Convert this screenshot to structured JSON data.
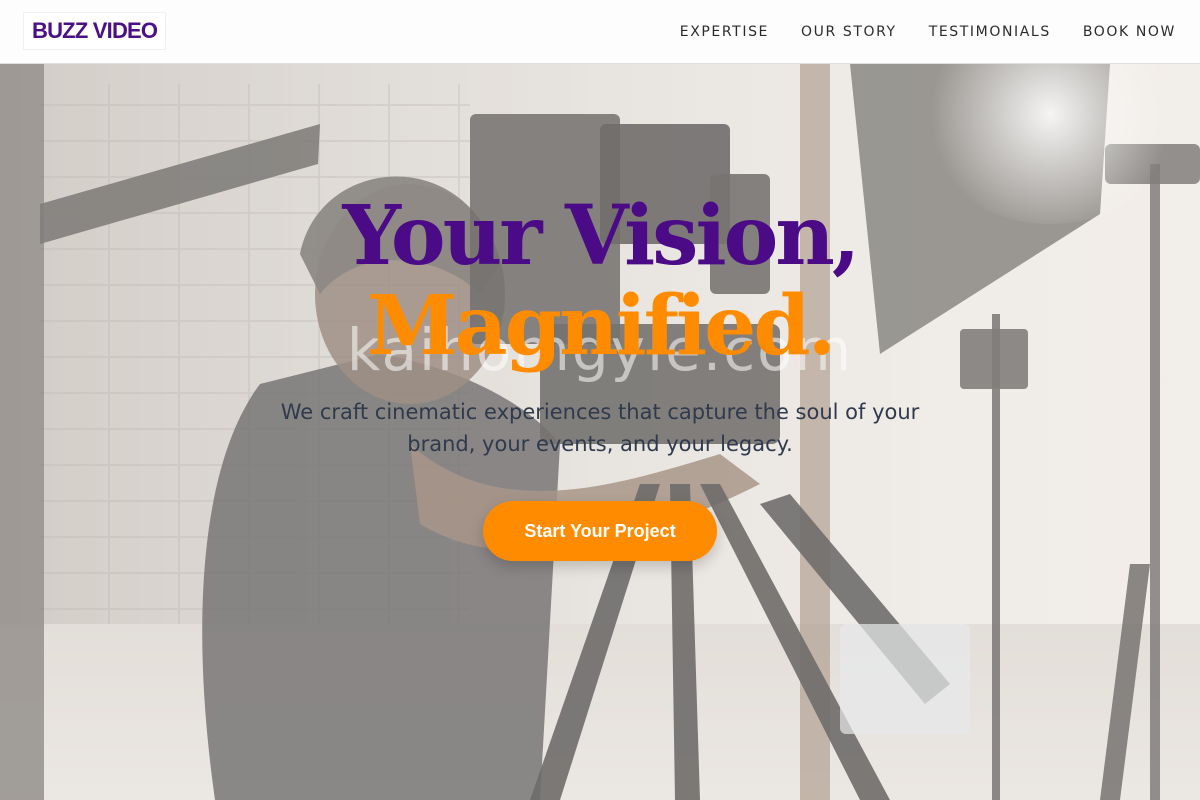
{
  "brand": {
    "logo_text": "BUZZ VIDEO"
  },
  "nav": {
    "items": [
      {
        "label": "EXPERTISE"
      },
      {
        "label": "OUR STORY"
      },
      {
        "label": "TESTIMONIALS"
      },
      {
        "label": "BOOK NOW"
      }
    ]
  },
  "hero": {
    "headline_line1": "Your Vision,",
    "headline_line2": "Magnified.",
    "watermark": "kaihomgyle.com",
    "subheadline": "We craft cinematic experiences that capture the soul of your brand, your events, and your legacy.",
    "cta_label": "Start Your Project"
  },
  "colors": {
    "brand_purple": "#4b0a86",
    "accent_orange": "#ff8c00",
    "text_dark": "#2f3a4c"
  }
}
